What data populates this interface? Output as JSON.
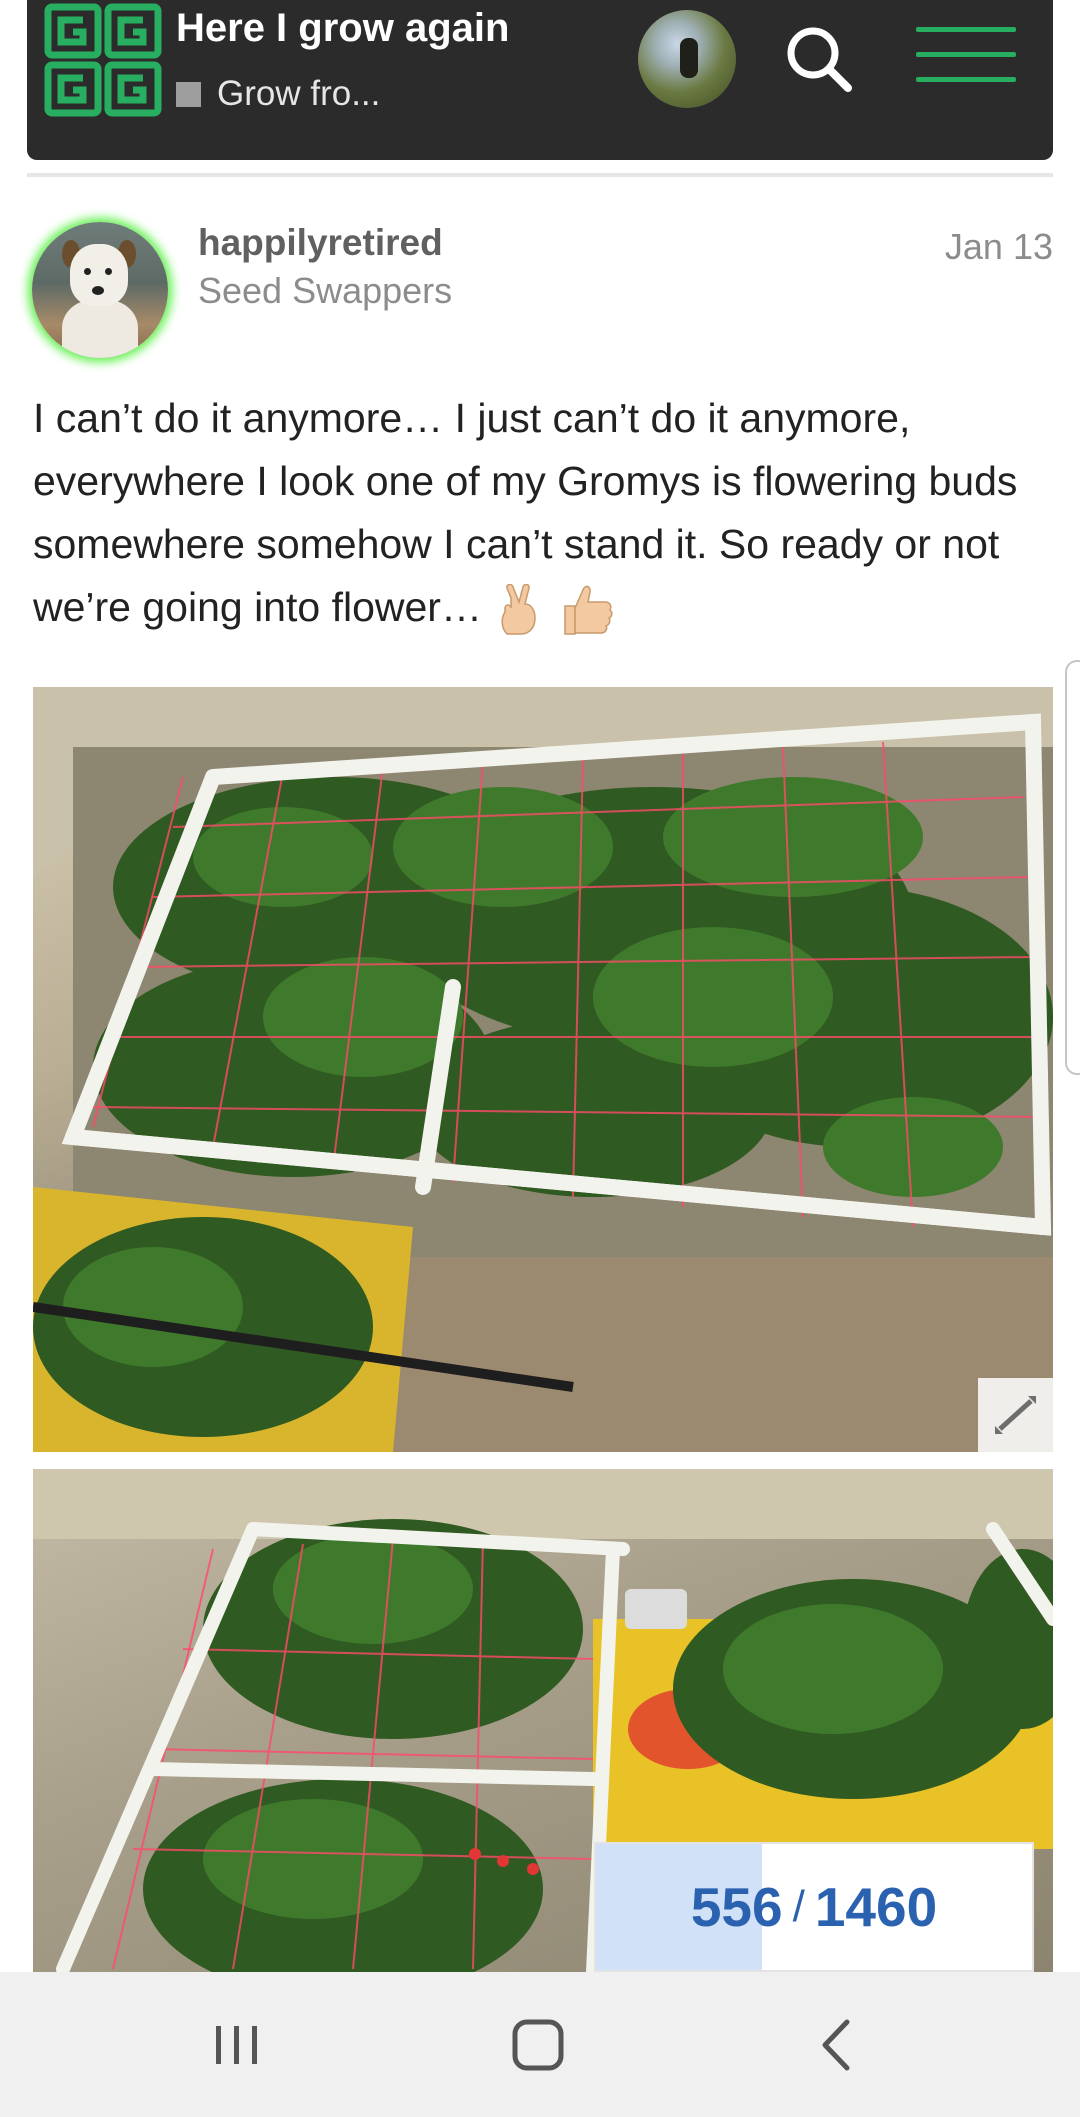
{
  "header": {
    "topic_title": "Here I grow again",
    "category": "Grow fro...",
    "category_color": "#9e9e9e",
    "brand_color": "#27ae60"
  },
  "post": {
    "username": "happilyretired",
    "user_title": "Seed Swappers",
    "date": "Jan 13",
    "body": "I can’t do it anymore… I just can’t do it anymore, everywhere I look one of my Gromys is flowering buds somewhere somehow I can’t stand it. So ready or not we’re going into flower…",
    "emojis": [
      "victory-hand",
      "thumbs-up"
    ],
    "images": [
      {
        "description_icon": "expand-icon"
      },
      {
        "description_icon": ""
      }
    ]
  },
  "timeline": {
    "current": "556",
    "separator": "/",
    "total": "1460",
    "fraction": 0.381,
    "color": "#2b62b0"
  },
  "icons": {
    "search": "search-icon",
    "menu": "hamburger-menu-icon",
    "expand": "expand-icon",
    "recent_apps": "recent-apps-icon",
    "home": "home-icon",
    "back": "back-icon"
  }
}
